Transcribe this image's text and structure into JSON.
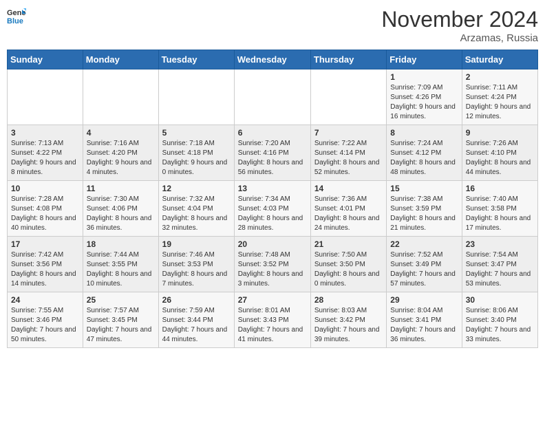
{
  "logo": {
    "general": "General",
    "blue": "Blue"
  },
  "title": "November 2024",
  "location": "Arzamas, Russia",
  "days_header": [
    "Sunday",
    "Monday",
    "Tuesday",
    "Wednesday",
    "Thursday",
    "Friday",
    "Saturday"
  ],
  "weeks": [
    [
      {
        "day": "",
        "info": ""
      },
      {
        "day": "",
        "info": ""
      },
      {
        "day": "",
        "info": ""
      },
      {
        "day": "",
        "info": ""
      },
      {
        "day": "",
        "info": ""
      },
      {
        "day": "1",
        "info": "Sunrise: 7:09 AM\nSunset: 4:26 PM\nDaylight: 9 hours and 16 minutes."
      },
      {
        "day": "2",
        "info": "Sunrise: 7:11 AM\nSunset: 4:24 PM\nDaylight: 9 hours and 12 minutes."
      }
    ],
    [
      {
        "day": "3",
        "info": "Sunrise: 7:13 AM\nSunset: 4:22 PM\nDaylight: 9 hours and 8 minutes."
      },
      {
        "day": "4",
        "info": "Sunrise: 7:16 AM\nSunset: 4:20 PM\nDaylight: 9 hours and 4 minutes."
      },
      {
        "day": "5",
        "info": "Sunrise: 7:18 AM\nSunset: 4:18 PM\nDaylight: 9 hours and 0 minutes."
      },
      {
        "day": "6",
        "info": "Sunrise: 7:20 AM\nSunset: 4:16 PM\nDaylight: 8 hours and 56 minutes."
      },
      {
        "day": "7",
        "info": "Sunrise: 7:22 AM\nSunset: 4:14 PM\nDaylight: 8 hours and 52 minutes."
      },
      {
        "day": "8",
        "info": "Sunrise: 7:24 AM\nSunset: 4:12 PM\nDaylight: 8 hours and 48 minutes."
      },
      {
        "day": "9",
        "info": "Sunrise: 7:26 AM\nSunset: 4:10 PM\nDaylight: 8 hours and 44 minutes."
      }
    ],
    [
      {
        "day": "10",
        "info": "Sunrise: 7:28 AM\nSunset: 4:08 PM\nDaylight: 8 hours and 40 minutes."
      },
      {
        "day": "11",
        "info": "Sunrise: 7:30 AM\nSunset: 4:06 PM\nDaylight: 8 hours and 36 minutes."
      },
      {
        "day": "12",
        "info": "Sunrise: 7:32 AM\nSunset: 4:04 PM\nDaylight: 8 hours and 32 minutes."
      },
      {
        "day": "13",
        "info": "Sunrise: 7:34 AM\nSunset: 4:03 PM\nDaylight: 8 hours and 28 minutes."
      },
      {
        "day": "14",
        "info": "Sunrise: 7:36 AM\nSunset: 4:01 PM\nDaylight: 8 hours and 24 minutes."
      },
      {
        "day": "15",
        "info": "Sunrise: 7:38 AM\nSunset: 3:59 PM\nDaylight: 8 hours and 21 minutes."
      },
      {
        "day": "16",
        "info": "Sunrise: 7:40 AM\nSunset: 3:58 PM\nDaylight: 8 hours and 17 minutes."
      }
    ],
    [
      {
        "day": "17",
        "info": "Sunrise: 7:42 AM\nSunset: 3:56 PM\nDaylight: 8 hours and 14 minutes."
      },
      {
        "day": "18",
        "info": "Sunrise: 7:44 AM\nSunset: 3:55 PM\nDaylight: 8 hours and 10 minutes."
      },
      {
        "day": "19",
        "info": "Sunrise: 7:46 AM\nSunset: 3:53 PM\nDaylight: 8 hours and 7 minutes."
      },
      {
        "day": "20",
        "info": "Sunrise: 7:48 AM\nSunset: 3:52 PM\nDaylight: 8 hours and 3 minutes."
      },
      {
        "day": "21",
        "info": "Sunrise: 7:50 AM\nSunset: 3:50 PM\nDaylight: 8 hours and 0 minutes."
      },
      {
        "day": "22",
        "info": "Sunrise: 7:52 AM\nSunset: 3:49 PM\nDaylight: 7 hours and 57 minutes."
      },
      {
        "day": "23",
        "info": "Sunrise: 7:54 AM\nSunset: 3:47 PM\nDaylight: 7 hours and 53 minutes."
      }
    ],
    [
      {
        "day": "24",
        "info": "Sunrise: 7:55 AM\nSunset: 3:46 PM\nDaylight: 7 hours and 50 minutes."
      },
      {
        "day": "25",
        "info": "Sunrise: 7:57 AM\nSunset: 3:45 PM\nDaylight: 7 hours and 47 minutes."
      },
      {
        "day": "26",
        "info": "Sunrise: 7:59 AM\nSunset: 3:44 PM\nDaylight: 7 hours and 44 minutes."
      },
      {
        "day": "27",
        "info": "Sunrise: 8:01 AM\nSunset: 3:43 PM\nDaylight: 7 hours and 41 minutes."
      },
      {
        "day": "28",
        "info": "Sunrise: 8:03 AM\nSunset: 3:42 PM\nDaylight: 7 hours and 39 minutes."
      },
      {
        "day": "29",
        "info": "Sunrise: 8:04 AM\nSunset: 3:41 PM\nDaylight: 7 hours and 36 minutes."
      },
      {
        "day": "30",
        "info": "Sunrise: 8:06 AM\nSunset: 3:40 PM\nDaylight: 7 hours and 33 minutes."
      }
    ]
  ]
}
